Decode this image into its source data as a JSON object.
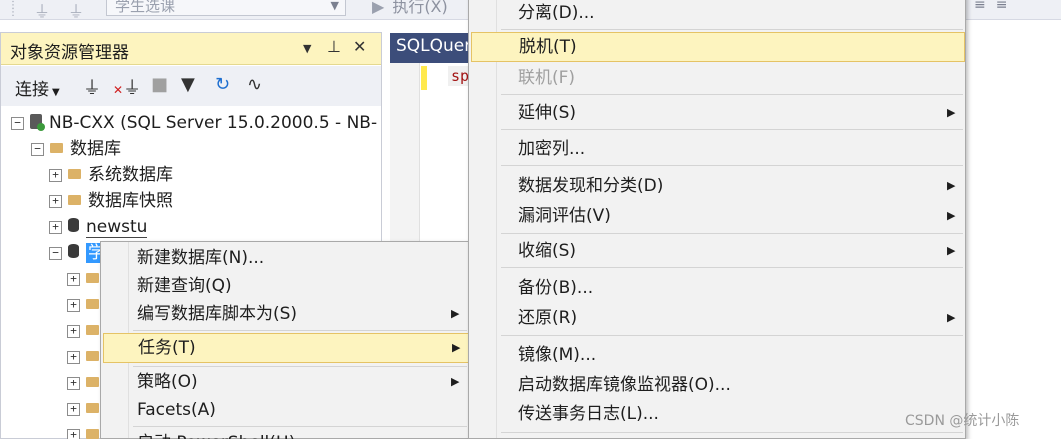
{
  "toolbar": {
    "db_combo": "学生选课",
    "execute": "执行(X)"
  },
  "object_explorer": {
    "title": "对象资源管理器",
    "connect": "连接",
    "tree": {
      "server": "NB-CXX (SQL Server 15.0.2000.5 - NB-",
      "databases": "数据库",
      "system_databases": "系统数据库",
      "snapshots": "数据库快照",
      "newstu": "newstu",
      "selected_db_partial": "学"
    }
  },
  "editor": {
    "tab_title": "SQLQuery",
    "code_snippet": "sp"
  },
  "context_menu_main": [
    {
      "label": "新建数据库(N)...",
      "submenu": false
    },
    {
      "label": "新建查询(Q)",
      "submenu": false
    },
    {
      "label": "编写数据库脚本为(S)",
      "submenu": true
    },
    {
      "label": "任务(T)",
      "submenu": true,
      "highlighted": true
    },
    {
      "label": "策略(O)",
      "submenu": true
    },
    {
      "label": "Facets(A)",
      "submenu": false
    },
    {
      "label": "启动 PowerShell(H)",
      "submenu": false
    }
  ],
  "context_menu_tasks": [
    {
      "label": "分离(D)...",
      "submenu": false
    },
    {
      "label": "脱机(T)",
      "submenu": false,
      "highlighted": true
    },
    {
      "label": "联机(F)",
      "submenu": false,
      "disabled": true
    },
    {
      "label": "延伸(S)",
      "submenu": true
    },
    {
      "label": "加密列...",
      "submenu": false
    },
    {
      "label": "数据发现和分类(D)",
      "submenu": true
    },
    {
      "label": "漏洞评估(V)",
      "submenu": true
    },
    {
      "label": "收缩(S)",
      "submenu": true
    },
    {
      "label": "备份(B)...",
      "submenu": false
    },
    {
      "label": "还原(R)",
      "submenu": true
    },
    {
      "label": "镜像(M)...",
      "submenu": false
    },
    {
      "label": "启动数据库镜像监视器(O)...",
      "submenu": false
    },
    {
      "label": "传送事务日志(L)...",
      "submenu": false
    }
  ],
  "watermark": "CSDN @统计小陈",
  "icons": {
    "pin": "pin-icon",
    "close": "close-icon",
    "dropdown": "dropdown-arrow-icon",
    "submenu": "submenu-arrow-icon"
  },
  "colors": {
    "highlight": "#fdf4bf",
    "selection": "#3399ff",
    "tab_active": "#3c4d7a"
  }
}
